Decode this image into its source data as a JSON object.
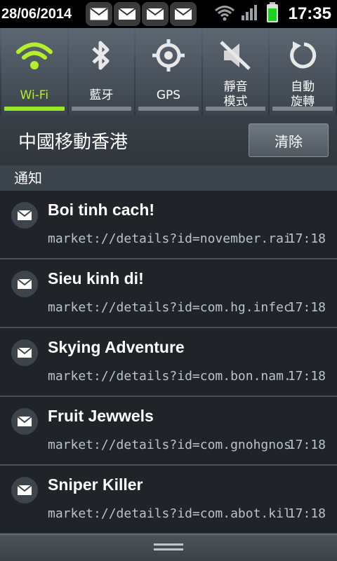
{
  "status_bar": {
    "date": "28/06/2014",
    "clock": "17:35",
    "notification_icons": [
      "envelope-icon",
      "envelope-icon",
      "envelope-icon",
      "envelope-icon"
    ],
    "indicators": [
      "wifi-signal-icon",
      "cellular-signal-icon",
      "battery-icon"
    ],
    "battery_color": "#1bd31b"
  },
  "quick_settings": {
    "accent_color": "#9ae62a",
    "toggles": [
      {
        "label": "Wi-Fi",
        "icon": "wifi-icon",
        "active": true
      },
      {
        "label": "藍牙",
        "icon": "bluetooth-icon",
        "active": false
      },
      {
        "label": "GPS",
        "icon": "gps-icon",
        "active": false
      },
      {
        "label": "靜音\n模式",
        "label_lines": [
          "靜音",
          "模式"
        ],
        "icon": "mute-icon",
        "active": false
      },
      {
        "label": "自動\n旋轉",
        "label_lines": [
          "自動",
          "旋轉"
        ],
        "icon": "rotate-icon",
        "active": false
      }
    ]
  },
  "carrier": "中國移動香港",
  "clear_button": "清除",
  "section_title": "通知",
  "notifications": [
    {
      "title": "Boi tinh cach!",
      "url": "market://details?id=november.rain.l",
      "time": "17:18"
    },
    {
      "title": "Sieu kinh di!",
      "url": "market://details?id=com.hg.infecctt",
      "time": "17:18"
    },
    {
      "title": "Skying Adventure",
      "url": "market://details?id=com.bon.nam.sa",
      "time": "17:18"
    },
    {
      "title": "Fruit Jewwels",
      "url": "market://details?id=com.gnohgnos.r",
      "time": "17:18"
    },
    {
      "title": "Sniper Killer",
      "url": "market://details?id=com.abot.killer",
      "time": "17:18"
    }
  ],
  "drag_handle_icon": "drag-handle-icon"
}
